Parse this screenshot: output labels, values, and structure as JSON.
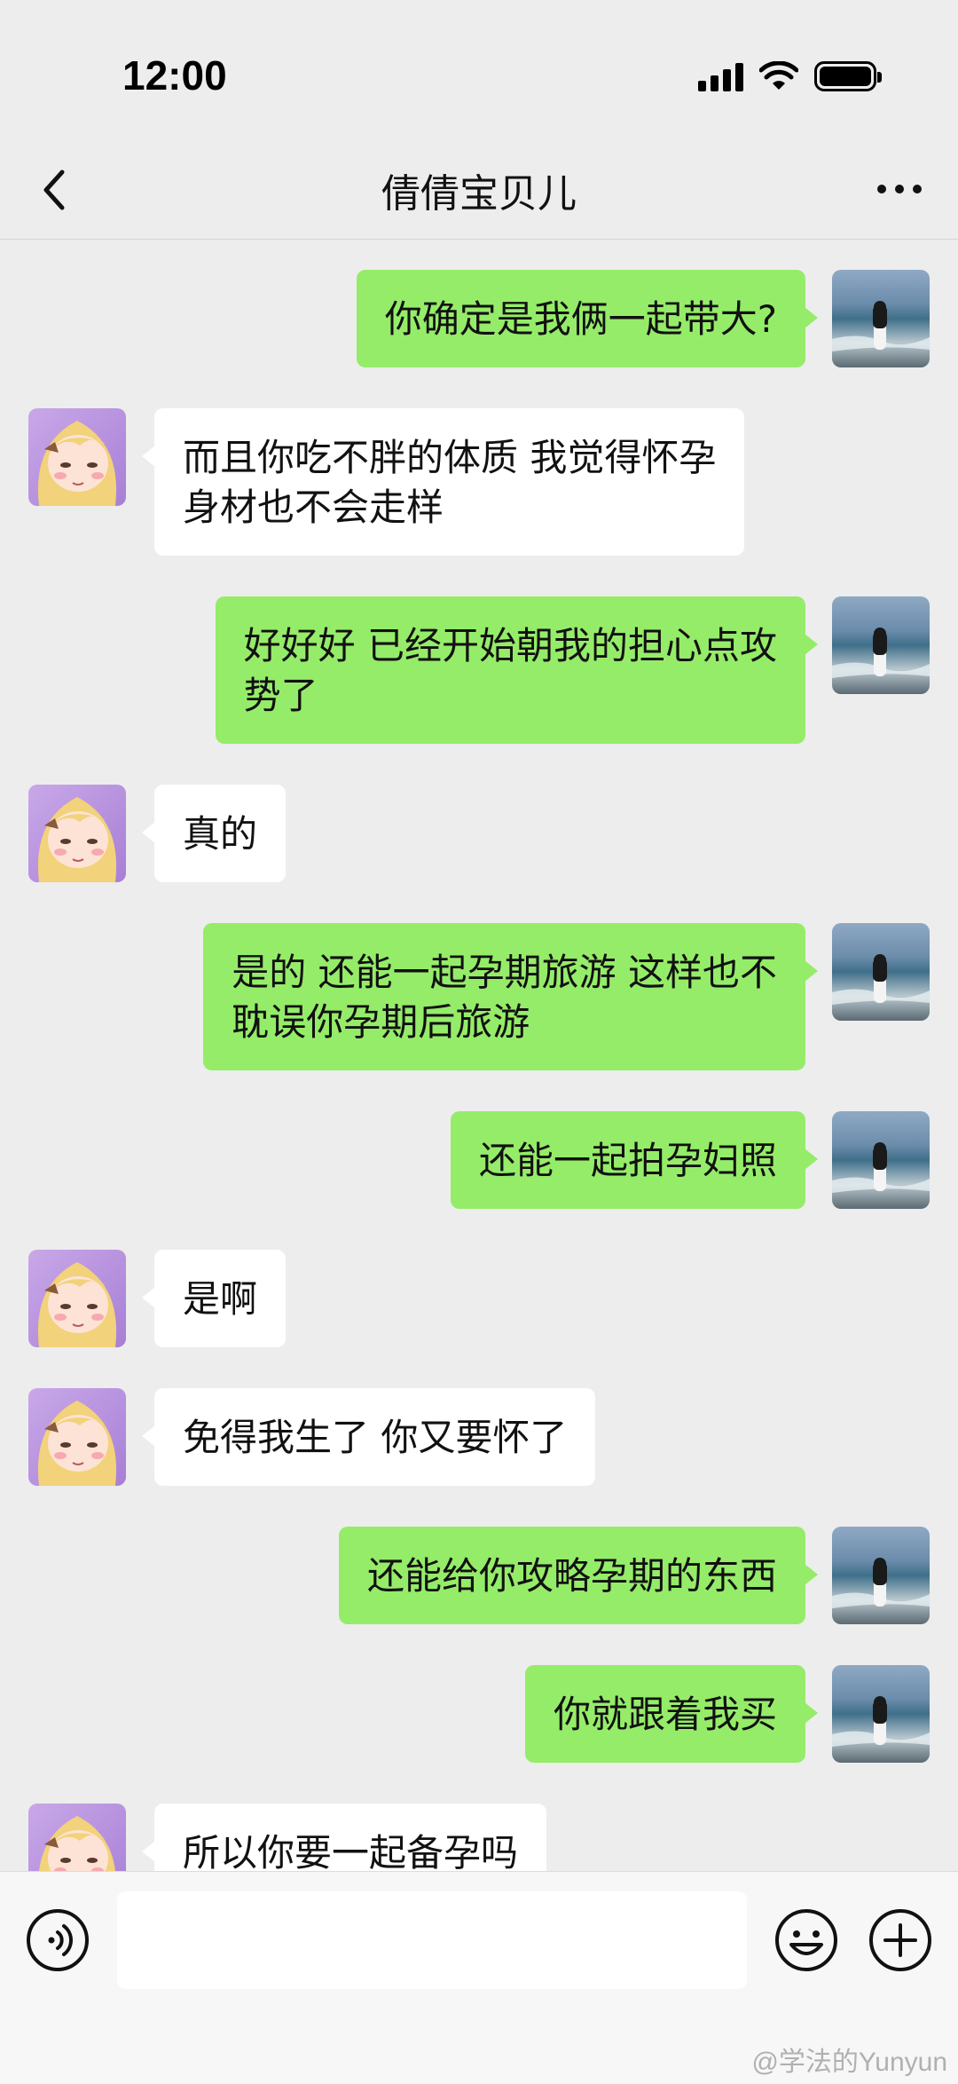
{
  "status_bar": {
    "time": "12:00"
  },
  "header": {
    "title": "倩倩宝贝儿"
  },
  "messages": [
    {
      "side": "out",
      "text": "你确定是我俩一起带大?"
    },
    {
      "side": "in",
      "text": "而且你吃不胖的体质 我觉得怀孕\n身材也不会走样"
    },
    {
      "side": "out",
      "text": "好好好 已经开始朝我的担心点攻\n势了"
    },
    {
      "side": "in",
      "text": "真的"
    },
    {
      "side": "out",
      "text": "是的 还能一起孕期旅游 这样也不\n耽误你孕期后旅游"
    },
    {
      "side": "out",
      "text": "还能一起拍孕妇照"
    },
    {
      "side": "in",
      "text": "是啊"
    },
    {
      "side": "in",
      "text": "免得我生了 你又要怀了"
    },
    {
      "side": "out",
      "text": "还能给你攻略孕期的东西"
    },
    {
      "side": "out",
      "text": "你就跟着我买"
    },
    {
      "side": "in",
      "text": "所以你要一起备孕吗"
    }
  ],
  "icons": {
    "back": "chevron-left-icon",
    "more": "more-dots-icon",
    "voice": "voice-icon",
    "emoji": "emoji-icon",
    "plus": "plus-icon"
  },
  "colors": {
    "outgoing_bubble": "#95ec69",
    "incoming_bubble": "#ffffff",
    "chat_background": "#ededed"
  },
  "input": {
    "value": "",
    "placeholder": ""
  },
  "watermark": "@学法的Yunyun"
}
